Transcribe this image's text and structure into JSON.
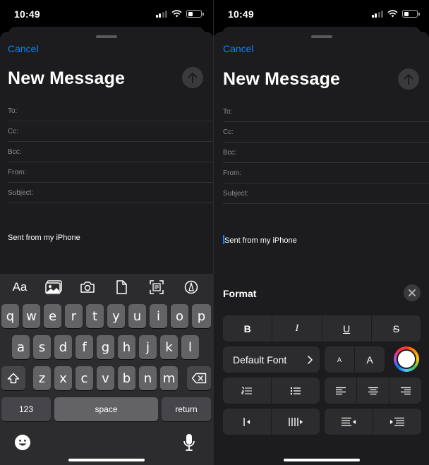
{
  "status": {
    "time": "10:49"
  },
  "compose": {
    "cancel_label": "Cancel",
    "title": "New Message",
    "fields": [
      {
        "label": "To:"
      },
      {
        "label": "Cc:"
      },
      {
        "label": "Bcc:"
      },
      {
        "label": "From:"
      },
      {
        "label": "Subject:"
      }
    ],
    "signature": "Sent from my iPhone"
  },
  "keyboard": {
    "toolbar": [
      {
        "label": "Aa",
        "icon": "text-format-icon"
      },
      {
        "icon": "photo-library-icon"
      },
      {
        "icon": "camera-icon"
      },
      {
        "icon": "document-icon"
      },
      {
        "icon": "scan-document-icon"
      },
      {
        "icon": "markup-icon"
      }
    ],
    "row1": [
      "q",
      "w",
      "e",
      "r",
      "t",
      "y",
      "u",
      "i",
      "o",
      "p"
    ],
    "row2": [
      "a",
      "s",
      "d",
      "f",
      "g",
      "h",
      "j",
      "k",
      "l"
    ],
    "row3": [
      "z",
      "x",
      "c",
      "v",
      "b",
      "n",
      "m"
    ],
    "numbers_label": "123",
    "space_label": "space",
    "return_label": "return"
  },
  "format": {
    "title": "Format",
    "style_buttons": [
      "B",
      "I",
      "U",
      "S"
    ],
    "font_label": "Default Font",
    "size_small": "A",
    "size_large": "A"
  },
  "colors": {
    "accent": "#0a84ff",
    "sheet": "#1c1c1e",
    "key": "#636366",
    "key_dark": "#46464a"
  }
}
